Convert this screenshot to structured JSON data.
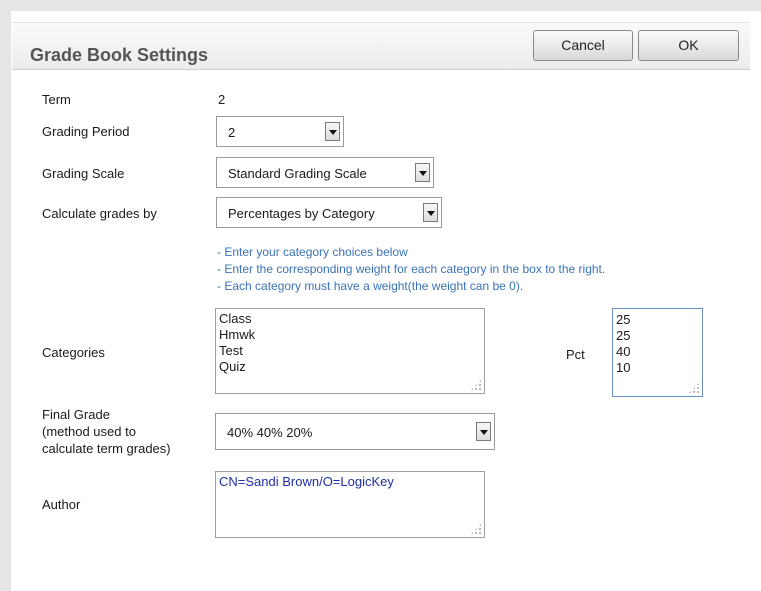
{
  "dialog": {
    "title": "Grade Book Settings",
    "cancel_label": "Cancel",
    "ok_label": "OK"
  },
  "form": {
    "term": {
      "label": "Term",
      "value": "2"
    },
    "grading_period": {
      "label": "Grading Period",
      "selected": "2"
    },
    "grading_scale": {
      "label": "Grading Scale",
      "selected": "Standard Grading Scale"
    },
    "calculate_by": {
      "label": "Calculate grades by",
      "selected": "Percentages by Category"
    },
    "hints": [
      "- Enter your category choices below",
      "- Enter the corresponding weight for each category in the box to the right.",
      "- Each category must have a weight(the weight can be 0)."
    ],
    "categories": {
      "label": "Categories",
      "items": [
        "Class",
        "Hmwk",
        "Test",
        "Quiz"
      ]
    },
    "pct": {
      "label": "Pct",
      "items": [
        "25",
        "25",
        "40",
        "10"
      ]
    },
    "final_grade": {
      "label_lines": [
        "Final Grade",
        "(method used to",
        "calculate term grades)"
      ],
      "selected": "40% 40% 20%"
    },
    "author": {
      "label": "Author",
      "value": "CN=Sandi Brown/O=LogicKey"
    }
  },
  "colors": {
    "hint_text": "#3b73b9",
    "author_text": "#1f2fa8",
    "title_text": "#555555"
  }
}
